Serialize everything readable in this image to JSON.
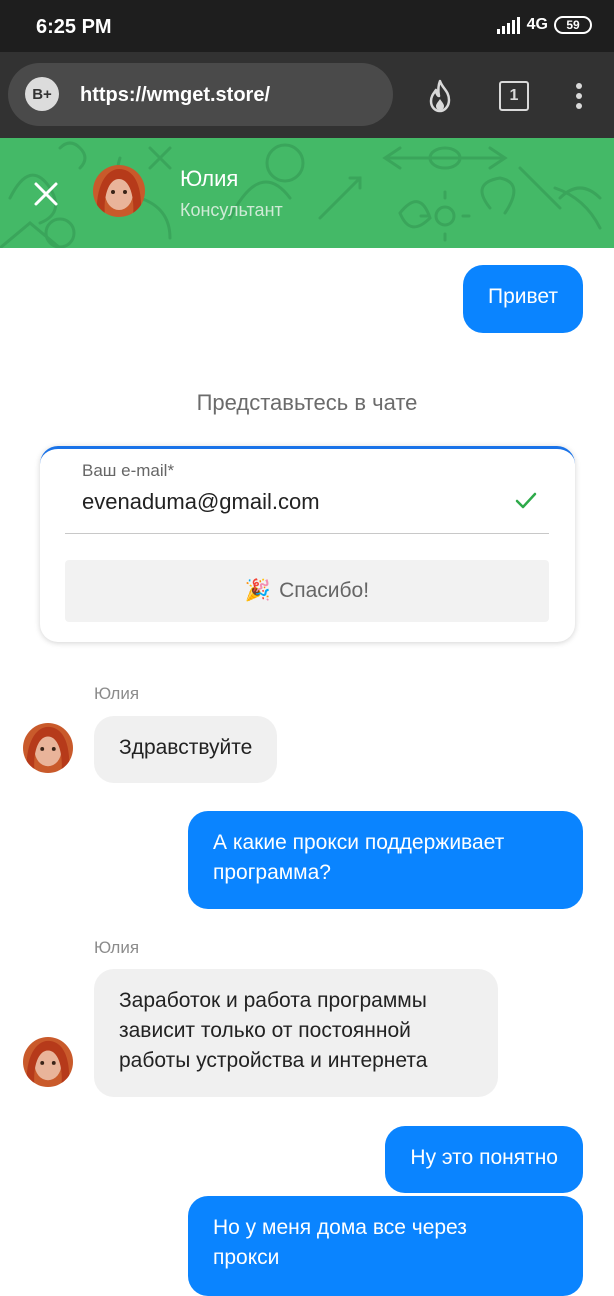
{
  "status_bar": {
    "time": "6:25 PM",
    "network": "4G",
    "battery": "59"
  },
  "browser": {
    "site_badge": "B+",
    "url": "https://wmget.store/",
    "tab_count": "1",
    "icons": [
      "fire-icon",
      "tabs-icon",
      "menu-dots-icon"
    ]
  },
  "chat_header": {
    "agent_name": "Юлия",
    "agent_role": "Консультант",
    "background_color": "#44b967"
  },
  "intro_form": {
    "title": "Представьтесь в чате",
    "email_label": "Ваш e-mail*",
    "email_value": "evenaduma@gmail.com",
    "button_emoji": "🎉",
    "button_label": "Спасибо!"
  },
  "messages": [
    {
      "from": "user",
      "text": "Привет"
    },
    {
      "from": "agent",
      "sender": "Юлия",
      "text": "Здравствуйте"
    },
    {
      "from": "user",
      "text": "А какие прокси поддерживает\nпрограмма?"
    },
    {
      "from": "agent",
      "sender": "Юлия",
      "text": "Заработок и работа программы\nзависит только от постоянной\nработы устройства и интернета"
    },
    {
      "from": "user",
      "text": "Ну это понятно"
    },
    {
      "from": "user",
      "text": "Но у меня дома все через\nпрокси"
    }
  ],
  "colors": {
    "user_bubble": "#0a84ff",
    "agent_bubble": "#f0f0f0",
    "accent": "#1a73e8"
  }
}
